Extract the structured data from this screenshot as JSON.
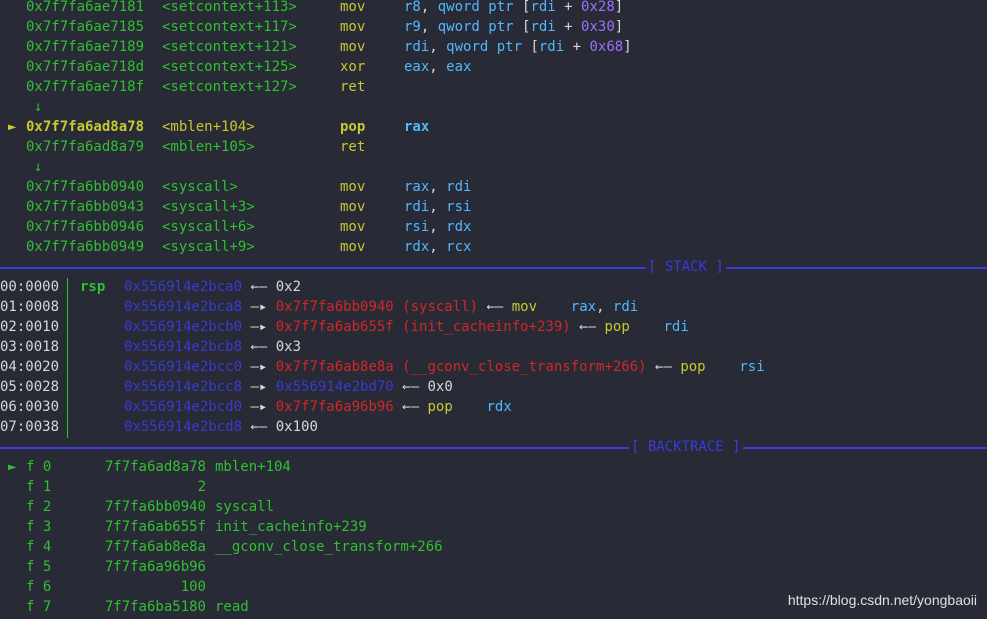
{
  "disasm": [
    {
      "addr": "0x7f7fa6ae7181",
      "sym": "<setcontext+113>",
      "mn": "mov",
      "ops": [
        [
          "r8",
          "c"
        ],
        [
          ", ",
          "w"
        ],
        [
          "qword ptr",
          "c"
        ],
        [
          " [",
          "w"
        ],
        [
          "rdi",
          "c"
        ],
        [
          " + ",
          "w"
        ],
        [
          "0x28",
          "p"
        ],
        [
          "]",
          "w"
        ]
      ]
    },
    {
      "addr": "0x7f7fa6ae7185",
      "sym": "<setcontext+117>",
      "mn": "mov",
      "ops": [
        [
          "r9",
          "c"
        ],
        [
          ", ",
          "w"
        ],
        [
          "qword ptr",
          "c"
        ],
        [
          " [",
          "w"
        ],
        [
          "rdi",
          "c"
        ],
        [
          " + ",
          "w"
        ],
        [
          "0x30",
          "p"
        ],
        [
          "]",
          "w"
        ]
      ]
    },
    {
      "addr": "0x7f7fa6ae7189",
      "sym": "<setcontext+121>",
      "mn": "mov",
      "ops": [
        [
          "rdi",
          "c"
        ],
        [
          ", ",
          "w"
        ],
        [
          "qword ptr",
          "c"
        ],
        [
          " [",
          "w"
        ],
        [
          "rdi",
          "c"
        ],
        [
          " + ",
          "w"
        ],
        [
          "0x68",
          "p"
        ],
        [
          "]",
          "w"
        ]
      ]
    },
    {
      "addr": "0x7f7fa6ae718d",
      "sym": "<setcontext+125>",
      "mn": "xor",
      "ops": [
        [
          "eax",
          "c"
        ],
        [
          ", ",
          "w"
        ],
        [
          "eax",
          "c"
        ]
      ]
    },
    {
      "addr": "0x7f7fa6ae718f",
      "sym": "<setcontext+127>",
      "mn": "ret",
      "ops": []
    },
    {
      "arrow": "↓"
    },
    {
      "addr": "0x7f7fa6ad8a78",
      "sym": "<mblen+104>",
      "mn": "pop",
      "ops": [
        [
          "rax",
          "c"
        ]
      ],
      "current": true,
      "marker": "►"
    },
    {
      "addr": "0x7f7fa6ad8a79",
      "sym": "<mblen+105>",
      "mn": "ret",
      "ops": []
    },
    {
      "arrow": "↓"
    },
    {
      "addr": "0x7f7fa6bb0940",
      "sym": "<syscall>",
      "mn": "mov",
      "ops": [
        [
          "rax",
          "c"
        ],
        [
          ", ",
          "w"
        ],
        [
          "rdi",
          "c"
        ]
      ]
    },
    {
      "addr": "0x7f7fa6bb0943",
      "sym": "<syscall+3>",
      "mn": "mov",
      "ops": [
        [
          "rdi",
          "c"
        ],
        [
          ", ",
          "w"
        ],
        [
          "rsi",
          "c"
        ]
      ]
    },
    {
      "addr": "0x7f7fa6bb0946",
      "sym": "<syscall+6>",
      "mn": "mov",
      "ops": [
        [
          "rsi",
          "c"
        ],
        [
          ", ",
          "w"
        ],
        [
          "rdx",
          "c"
        ]
      ]
    },
    {
      "addr": "0x7f7fa6bb0949",
      "sym": "<syscall+9>",
      "mn": "mov",
      "ops": [
        [
          "rdx",
          "c"
        ],
        [
          ", ",
          "w"
        ],
        [
          "rcx",
          "c"
        ]
      ]
    }
  ],
  "stack_header": "[ STACK ]",
  "stack": [
    {
      "idx": "00:0000",
      "reg": "rsp",
      "parts": [
        [
          "0x5569l4e2bca0",
          "b"
        ],
        [
          " ←— ",
          "w"
        ],
        [
          "0x2",
          "w"
        ]
      ]
    },
    {
      "idx": "01:0008",
      "reg": "",
      "parts": [
        [
          "0x556914e2bca8",
          "b"
        ],
        [
          " —▸ ",
          "w"
        ],
        [
          "0x7f7fa6bb0940 (syscall)",
          "r"
        ],
        [
          " ←— ",
          "w"
        ],
        [
          "mov    ",
          "y"
        ],
        [
          "rax",
          "c"
        ],
        [
          ", ",
          "w"
        ],
        [
          "rdi",
          "c"
        ]
      ]
    },
    {
      "idx": "02:0010",
      "reg": "",
      "parts": [
        [
          "0x556914e2bcb0",
          "b"
        ],
        [
          " —▸ ",
          "w"
        ],
        [
          "0x7f7fa6ab655f (init_cacheinfo+239)",
          "r"
        ],
        [
          " ←— ",
          "w"
        ],
        [
          "pop    ",
          "y"
        ],
        [
          "rdi",
          "c"
        ]
      ]
    },
    {
      "idx": "03:0018",
      "reg": "",
      "parts": [
        [
          "0x556914e2bcb8",
          "b"
        ],
        [
          " ←— ",
          "w"
        ],
        [
          "0x3",
          "w"
        ]
      ]
    },
    {
      "idx": "04:0020",
      "reg": "",
      "parts": [
        [
          "0x556914e2bcc0",
          "b"
        ],
        [
          " —▸ ",
          "w"
        ],
        [
          "0x7f7fa6ab8e8a (__gconv_close_transform+266)",
          "r"
        ],
        [
          " ←— ",
          "w"
        ],
        [
          "pop    ",
          "y"
        ],
        [
          "rsi",
          "c"
        ]
      ]
    },
    {
      "idx": "05:0028",
      "reg": "",
      "parts": [
        [
          "0x556914e2bcc8",
          "b"
        ],
        [
          " —▸ ",
          "w"
        ],
        [
          "0x556914e2bd70",
          "b"
        ],
        [
          " ←— ",
          "w"
        ],
        [
          "0x0",
          "w"
        ]
      ]
    },
    {
      "idx": "06:0030",
      "reg": "",
      "parts": [
        [
          "0x556914e2bcd0",
          "b"
        ],
        [
          " —▸ ",
          "w"
        ],
        [
          "0x7f7fa6a96b96",
          "r"
        ],
        [
          " ←— ",
          "w"
        ],
        [
          "pop    ",
          "y"
        ],
        [
          "rdx",
          "c"
        ]
      ]
    },
    {
      "idx": "07:0038",
      "reg": "",
      "parts": [
        [
          "0x556914e2bcd8",
          "b"
        ],
        [
          " ←— ",
          "w"
        ],
        [
          "0x100",
          "w"
        ]
      ]
    }
  ],
  "backtrace_header": "[ BACKTRACE ]",
  "backtrace": [
    {
      "marker": "►",
      "frame": "f 0",
      "addr": "7f7fa6ad8a78",
      "sym": "mblen+104"
    },
    {
      "marker": "",
      "frame": "f 1",
      "addr": "2",
      "sym": ""
    },
    {
      "marker": "",
      "frame": "f 2",
      "addr": "7f7fa6bb0940",
      "sym": "syscall"
    },
    {
      "marker": "",
      "frame": "f 3",
      "addr": "7f7fa6ab655f",
      "sym": "init_cacheinfo+239"
    },
    {
      "marker": "",
      "frame": "f 4",
      "addr": "7f7fa6ab8e8a",
      "sym": "__gconv_close_transform+266"
    },
    {
      "marker": "",
      "frame": "f 5",
      "addr": "7f7fa6a96b96",
      "sym": ""
    },
    {
      "marker": "",
      "frame": "f 6",
      "addr": "100",
      "sym": ""
    },
    {
      "marker": "",
      "frame": "f 7",
      "addr": "7f7fa6ba5180",
      "sym": "read"
    }
  ],
  "watermark": "https://blog.csdn.net/yongbaoii",
  "colors": {
    "background": "#282a36",
    "green": "#30c030",
    "yellow": "#c8c830",
    "cyan": "#50b8ff",
    "purple": "#9a70ff",
    "blue": "#3a3ad0",
    "red": "#d02828",
    "rule": "#3a3ae0"
  }
}
